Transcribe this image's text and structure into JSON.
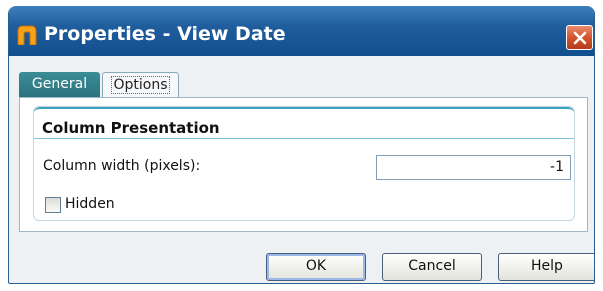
{
  "window": {
    "title": "Properties - View Date",
    "app_icon": "folder-arch-icon",
    "close_icon": "close-icon",
    "accent": "#1f5d9d",
    "close_color": "#d1512b"
  },
  "tabs": [
    {
      "label": "General",
      "selected": false
    },
    {
      "label": "Options",
      "selected": true
    }
  ],
  "group": {
    "title": "Column Presentation"
  },
  "fields": {
    "column_width": {
      "label": "Column width (pixels):",
      "value": "-1"
    },
    "hidden": {
      "label": "Hidden",
      "checked": false
    }
  },
  "buttons": {
    "ok": "OK",
    "cancel": "Cancel",
    "help": "Help"
  }
}
